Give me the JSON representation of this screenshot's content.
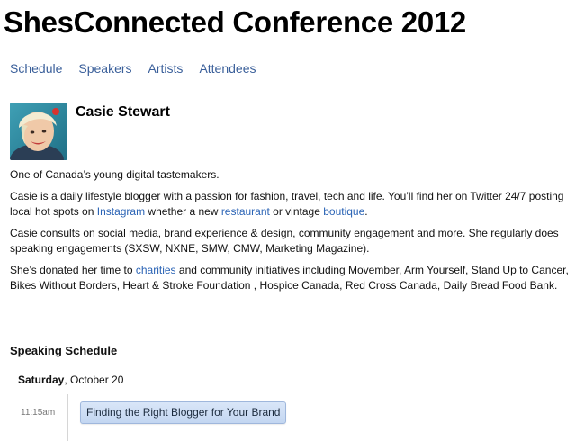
{
  "site": {
    "title": "ShesConnected Conference 2012"
  },
  "nav": {
    "items": [
      {
        "label": "Schedule"
      },
      {
        "label": "Speakers"
      },
      {
        "label": "Artists"
      },
      {
        "label": "Attendees"
      }
    ]
  },
  "speaker": {
    "name": "Casie Stewart"
  },
  "bio": {
    "p1": "One of Canada’s young digital tastemakers.",
    "p2": {
      "t1": "Casie is a daily lifestyle blogger with a passion for fashion, travel, tech and life. You’ll find her on Twitter 24/7 posting local hot spots on ",
      "link1": "Instagram",
      "t2": " whether a new ",
      "link2": "restaurant",
      "t3": "  or vintage ",
      "link3": "boutique",
      "t4": "."
    },
    "p3": "Casie consults on social media, brand experience & design, community engagement and more. She regularly does speaking engagements (SXSW, NXNE, SMW, CMW, Marketing Magazine).",
    "p4": {
      "t1": "She’s donated her time to ",
      "link1": "charities",
      "t2": " and community initiatives including Movember, Arm Yourself, Stand Up to Cancer, Bikes Without Borders, Heart & Stroke Foundation , Hospice Canada, Red Cross Canada, Daily Bread Food Bank."
    }
  },
  "schedule": {
    "heading": "Speaking Schedule",
    "day_bold": "Saturday",
    "day_rest": ", October 20",
    "sessions": [
      {
        "time": "11:15am",
        "title": "Finding the Right Blogger for Your Brand"
      }
    ]
  },
  "colors": {
    "link": "#2a63b5",
    "nav_link": "#3a5f9a",
    "session_bg": "#c9dbf3"
  }
}
